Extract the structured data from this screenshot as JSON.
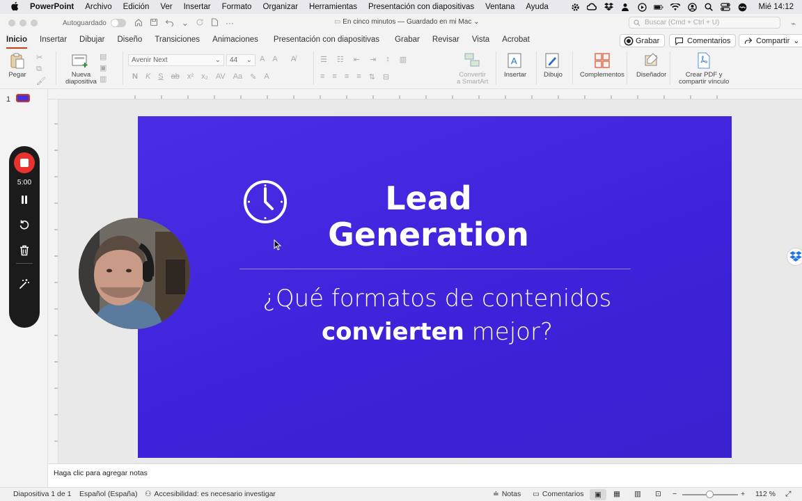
{
  "menubar": {
    "app": "PowerPoint",
    "items": [
      "Archivo",
      "Edición",
      "Ver",
      "Insertar",
      "Formato",
      "Organizar",
      "Herramientas",
      "Presentación con diapositivas",
      "Ventana",
      "Ayuda"
    ],
    "clock": "Mié  14:12"
  },
  "titlebar": {
    "autosave_label": "Autoguardado",
    "doc_title": "En cinco minutos — Guardado en mi Mac",
    "search_placeholder": "Buscar (Cmd + Ctrl + U)"
  },
  "ribbon_tabs": {
    "tabs": [
      "Inicio",
      "Insertar",
      "Dibujar",
      "Diseño",
      "Transiciones",
      "Animaciones",
      "Presentación con diapositivas",
      "Grabar",
      "Revisar",
      "Vista",
      "Acrobat"
    ],
    "active": "Inicio",
    "record_label": "Grabar",
    "comments_label": "Comentarios",
    "share_label": "Compartir"
  },
  "ribbon": {
    "paste_label": "Pegar",
    "new_slide_label_1": "Nueva",
    "new_slide_label_2": "diapositiva",
    "font_name": "Avenir Next",
    "font_size": "44",
    "smartart_label_1": "Convertir",
    "smartart_label_2": "a SmartArt",
    "insert_label": "Insertar",
    "draw_label": "Dibujo",
    "addins_label": "Complementos",
    "designer_label": "Diseñador",
    "pdf_label_1": "Crear PDF y",
    "pdf_label_2": "compartir vínculo"
  },
  "thumbnails": {
    "slide_number": "1"
  },
  "slide": {
    "title_line1": "Lead",
    "title_line2": "Generation",
    "subtitle_line1": "¿Qué formatos de contenidos",
    "subtitle_bold": "convierten",
    "subtitle_rest": " mejor?",
    "background_color": "#4129e0"
  },
  "recorder": {
    "time": "5:00"
  },
  "notes": {
    "placeholder": "Haga clic para agregar notas"
  },
  "statusbar": {
    "slide_info": "Diapositiva 1 de 1",
    "language": "Español (España)",
    "accessibility": "Accesibilidad: es necesario investigar",
    "notes_label": "Notas",
    "comments_label": "Comentarios",
    "zoom": "112 %"
  }
}
